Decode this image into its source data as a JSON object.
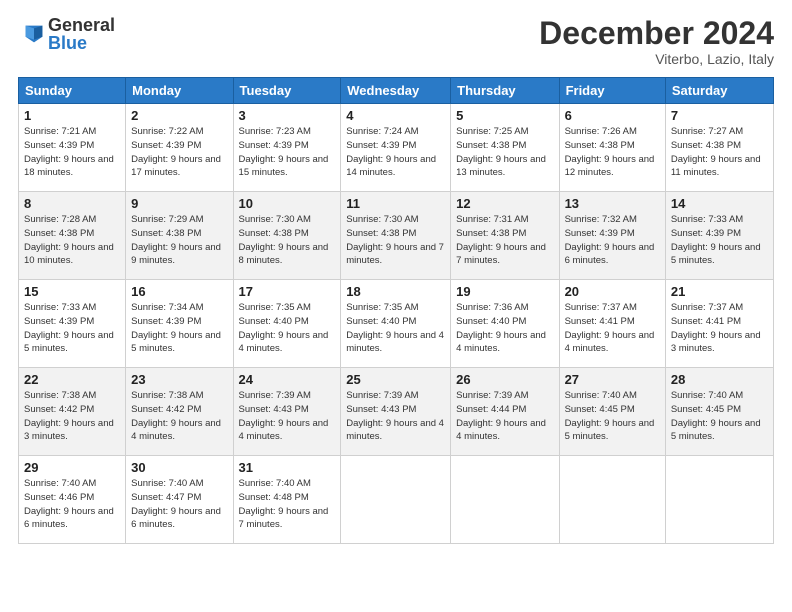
{
  "header": {
    "logo_general": "General",
    "logo_blue": "Blue",
    "title": "December 2024",
    "location": "Viterbo, Lazio, Italy"
  },
  "days_of_week": [
    "Sunday",
    "Monday",
    "Tuesday",
    "Wednesday",
    "Thursday",
    "Friday",
    "Saturday"
  ],
  "weeks": [
    [
      {
        "day": "1",
        "sunrise": "Sunrise: 7:21 AM",
        "sunset": "Sunset: 4:39 PM",
        "daylight": "Daylight: 9 hours and 18 minutes."
      },
      {
        "day": "2",
        "sunrise": "Sunrise: 7:22 AM",
        "sunset": "Sunset: 4:39 PM",
        "daylight": "Daylight: 9 hours and 17 minutes."
      },
      {
        "day": "3",
        "sunrise": "Sunrise: 7:23 AM",
        "sunset": "Sunset: 4:39 PM",
        "daylight": "Daylight: 9 hours and 15 minutes."
      },
      {
        "day": "4",
        "sunrise": "Sunrise: 7:24 AM",
        "sunset": "Sunset: 4:39 PM",
        "daylight": "Daylight: 9 hours and 14 minutes."
      },
      {
        "day": "5",
        "sunrise": "Sunrise: 7:25 AM",
        "sunset": "Sunset: 4:38 PM",
        "daylight": "Daylight: 9 hours and 13 minutes."
      },
      {
        "day": "6",
        "sunrise": "Sunrise: 7:26 AM",
        "sunset": "Sunset: 4:38 PM",
        "daylight": "Daylight: 9 hours and 12 minutes."
      },
      {
        "day": "7",
        "sunrise": "Sunrise: 7:27 AM",
        "sunset": "Sunset: 4:38 PM",
        "daylight": "Daylight: 9 hours and 11 minutes."
      }
    ],
    [
      {
        "day": "8",
        "sunrise": "Sunrise: 7:28 AM",
        "sunset": "Sunset: 4:38 PM",
        "daylight": "Daylight: 9 hours and 10 minutes."
      },
      {
        "day": "9",
        "sunrise": "Sunrise: 7:29 AM",
        "sunset": "Sunset: 4:38 PM",
        "daylight": "Daylight: 9 hours and 9 minutes."
      },
      {
        "day": "10",
        "sunrise": "Sunrise: 7:30 AM",
        "sunset": "Sunset: 4:38 PM",
        "daylight": "Daylight: 9 hours and 8 minutes."
      },
      {
        "day": "11",
        "sunrise": "Sunrise: 7:30 AM",
        "sunset": "Sunset: 4:38 PM",
        "daylight": "Daylight: 9 hours and 7 minutes."
      },
      {
        "day": "12",
        "sunrise": "Sunrise: 7:31 AM",
        "sunset": "Sunset: 4:38 PM",
        "daylight": "Daylight: 9 hours and 7 minutes."
      },
      {
        "day": "13",
        "sunrise": "Sunrise: 7:32 AM",
        "sunset": "Sunset: 4:39 PM",
        "daylight": "Daylight: 9 hours and 6 minutes."
      },
      {
        "day": "14",
        "sunrise": "Sunrise: 7:33 AM",
        "sunset": "Sunset: 4:39 PM",
        "daylight": "Daylight: 9 hours and 5 minutes."
      }
    ],
    [
      {
        "day": "15",
        "sunrise": "Sunrise: 7:33 AM",
        "sunset": "Sunset: 4:39 PM",
        "daylight": "Daylight: 9 hours and 5 minutes."
      },
      {
        "day": "16",
        "sunrise": "Sunrise: 7:34 AM",
        "sunset": "Sunset: 4:39 PM",
        "daylight": "Daylight: 9 hours and 5 minutes."
      },
      {
        "day": "17",
        "sunrise": "Sunrise: 7:35 AM",
        "sunset": "Sunset: 4:40 PM",
        "daylight": "Daylight: 9 hours and 4 minutes."
      },
      {
        "day": "18",
        "sunrise": "Sunrise: 7:35 AM",
        "sunset": "Sunset: 4:40 PM",
        "daylight": "Daylight: 9 hours and 4 minutes."
      },
      {
        "day": "19",
        "sunrise": "Sunrise: 7:36 AM",
        "sunset": "Sunset: 4:40 PM",
        "daylight": "Daylight: 9 hours and 4 minutes."
      },
      {
        "day": "20",
        "sunrise": "Sunrise: 7:37 AM",
        "sunset": "Sunset: 4:41 PM",
        "daylight": "Daylight: 9 hours and 4 minutes."
      },
      {
        "day": "21",
        "sunrise": "Sunrise: 7:37 AM",
        "sunset": "Sunset: 4:41 PM",
        "daylight": "Daylight: 9 hours and 3 minutes."
      }
    ],
    [
      {
        "day": "22",
        "sunrise": "Sunrise: 7:38 AM",
        "sunset": "Sunset: 4:42 PM",
        "daylight": "Daylight: 9 hours and 3 minutes."
      },
      {
        "day": "23",
        "sunrise": "Sunrise: 7:38 AM",
        "sunset": "Sunset: 4:42 PM",
        "daylight": "Daylight: 9 hours and 4 minutes."
      },
      {
        "day": "24",
        "sunrise": "Sunrise: 7:39 AM",
        "sunset": "Sunset: 4:43 PM",
        "daylight": "Daylight: 9 hours and 4 minutes."
      },
      {
        "day": "25",
        "sunrise": "Sunrise: 7:39 AM",
        "sunset": "Sunset: 4:43 PM",
        "daylight": "Daylight: 9 hours and 4 minutes."
      },
      {
        "day": "26",
        "sunrise": "Sunrise: 7:39 AM",
        "sunset": "Sunset: 4:44 PM",
        "daylight": "Daylight: 9 hours and 4 minutes."
      },
      {
        "day": "27",
        "sunrise": "Sunrise: 7:40 AM",
        "sunset": "Sunset: 4:45 PM",
        "daylight": "Daylight: 9 hours and 5 minutes."
      },
      {
        "day": "28",
        "sunrise": "Sunrise: 7:40 AM",
        "sunset": "Sunset: 4:45 PM",
        "daylight": "Daylight: 9 hours and 5 minutes."
      }
    ],
    [
      {
        "day": "29",
        "sunrise": "Sunrise: 7:40 AM",
        "sunset": "Sunset: 4:46 PM",
        "daylight": "Daylight: 9 hours and 6 minutes."
      },
      {
        "day": "30",
        "sunrise": "Sunrise: 7:40 AM",
        "sunset": "Sunset: 4:47 PM",
        "daylight": "Daylight: 9 hours and 6 minutes."
      },
      {
        "day": "31",
        "sunrise": "Sunrise: 7:40 AM",
        "sunset": "Sunset: 4:48 PM",
        "daylight": "Daylight: 9 hours and 7 minutes."
      },
      null,
      null,
      null,
      null
    ]
  ]
}
